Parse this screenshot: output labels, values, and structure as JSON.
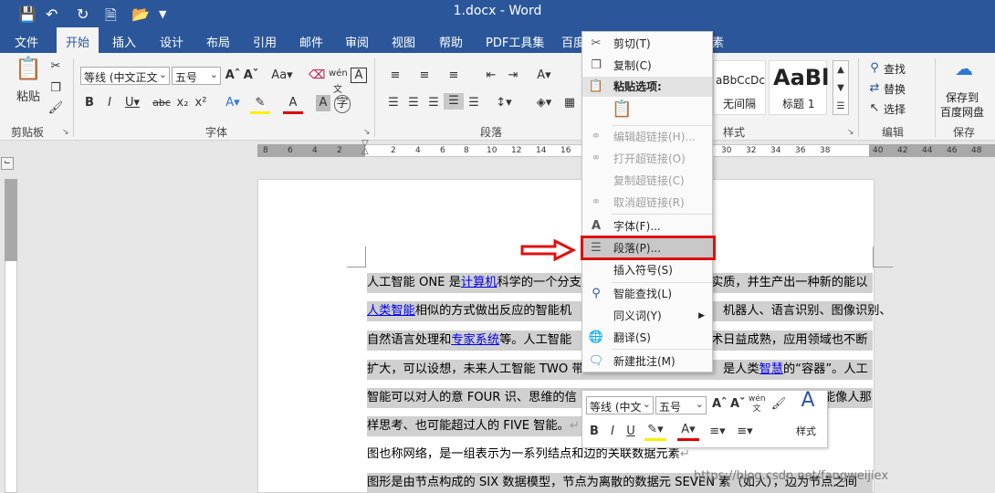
{
  "window": {
    "title": "1.docx - Word"
  },
  "tabs": [
    "文件",
    "开始",
    "插入",
    "设计",
    "布局",
    "引用",
    "邮件",
    "审阅",
    "视图",
    "帮助",
    "PDF工具集",
    "百度",
    "素"
  ],
  "ribbon": {
    "clipboard": {
      "paste_label": "粘贴",
      "group": "剪贴板"
    },
    "font": {
      "font_name": "等线 (中文正文",
      "font_size": "五号",
      "group": "字体"
    },
    "paragraph": {
      "group": "段落"
    },
    "styles": {
      "style1_preview": "aBbCcDc",
      "style1_name": "无间隔",
      "style2_preview": "AaBl",
      "style2_name": "标题 1",
      "group": "样式"
    },
    "editing": {
      "find": "查找",
      "replace": "替换",
      "select": "选择",
      "group": "编辑"
    },
    "save": {
      "label_line1": "保存到",
      "label_line2": "百度网盘",
      "group": "保存"
    }
  },
  "ruler": {
    "ticks_left": [
      "8",
      "6",
      "4",
      "2"
    ],
    "ticks_main": [
      "2",
      "4",
      "6",
      "8",
      "10",
      "12",
      "14",
      "16",
      "18",
      "20",
      "22",
      "24",
      "26",
      "28",
      "30",
      "32",
      "34",
      "36",
      "38"
    ],
    "ticks_right": [
      "40",
      "42",
      "44",
      "46",
      "48"
    ]
  },
  "document": {
    "line1": {
      "a": "人工智能 ONE 是",
      "link": "计算机",
      "b": "科学的一个分支",
      "c": "实质，并生产出一种新的能以"
    },
    "line2": {
      "link": "人类智能",
      "a": "相似的方式做出反应的智能机",
      "b": "机器人、语言识别、图像识别、"
    },
    "line3": {
      "a": "自然语言处理和",
      "link": "专家系统",
      "b": "等。人工智能",
      "c": "术日益成熟，应用领域也不断"
    },
    "line4": {
      "a": "扩大，可以设想，未来人工智能 TWO 带",
      "b": "是人类",
      "link": "智慧",
      "c": "的“容器”。人工"
    },
    "line5": {
      "a": "智能可以对人的意 FOUR 识、思维的信",
      "b": "能像人那"
    },
    "line6": {
      "a": "样思考、也可能超过人的 FIVE 智能。"
    },
    "line7": {
      "a": "图也称网络，是一组表示为一系列结点和边的关联数据元素"
    },
    "line8": {
      "a": "图形是由节点构成的 SIX 数据模型，节点为离散的数据元 SEVEN 素（如人），边为节点之间"
    }
  },
  "context_menu": {
    "cut": "剪切(T)",
    "copy": "复制(C)",
    "paste_options": "粘贴选项:",
    "edit_link": "编辑超链接(H)...",
    "open_link": "打开超链接(O)",
    "copy_link": "复制超链接(C)",
    "remove_link": "取消超链接(R)",
    "font": "字体(F)...",
    "paragraph": "段落(P)...",
    "insert_symbol": "插入符号(S)",
    "smart_lookup": "智能查找(L)",
    "synonyms": "同义词(Y)",
    "translate": "翻译(S)",
    "new_comment": "新建批注(M)"
  },
  "mini_toolbar": {
    "font_name": "等线 (中文",
    "font_size": "五号",
    "styles_label": "样式"
  },
  "watermark": "https://blog.csdn.net/fangweijiex",
  "colors": {
    "accent": "#2b579a",
    "highlight_red": "#e01010"
  }
}
